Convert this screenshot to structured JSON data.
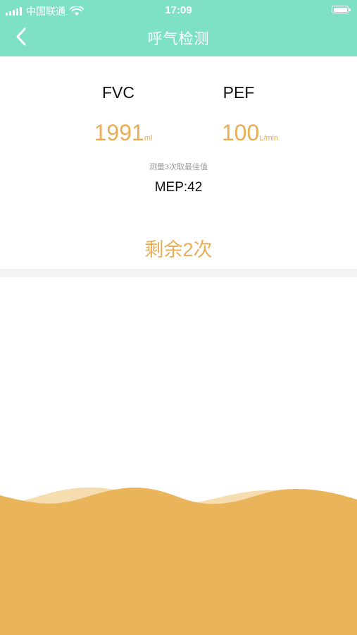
{
  "status_bar": {
    "carrier": "中国联通",
    "time": "17:09"
  },
  "header": {
    "title": "呼气检测"
  },
  "metrics": {
    "fvc": {
      "label": "FVC",
      "value": "1991",
      "unit": "ml"
    },
    "pef": {
      "label": "PEF",
      "value": "100",
      "unit": "L/min"
    }
  },
  "hint": "测量3次取最佳值",
  "mep": "MEP:42",
  "remaining": "剩余2次",
  "colors": {
    "header_bg": "#7ee0c5",
    "accent": "#e9ad55",
    "wave_front": "#eab45a",
    "wave_back": "#f6ddb0"
  }
}
